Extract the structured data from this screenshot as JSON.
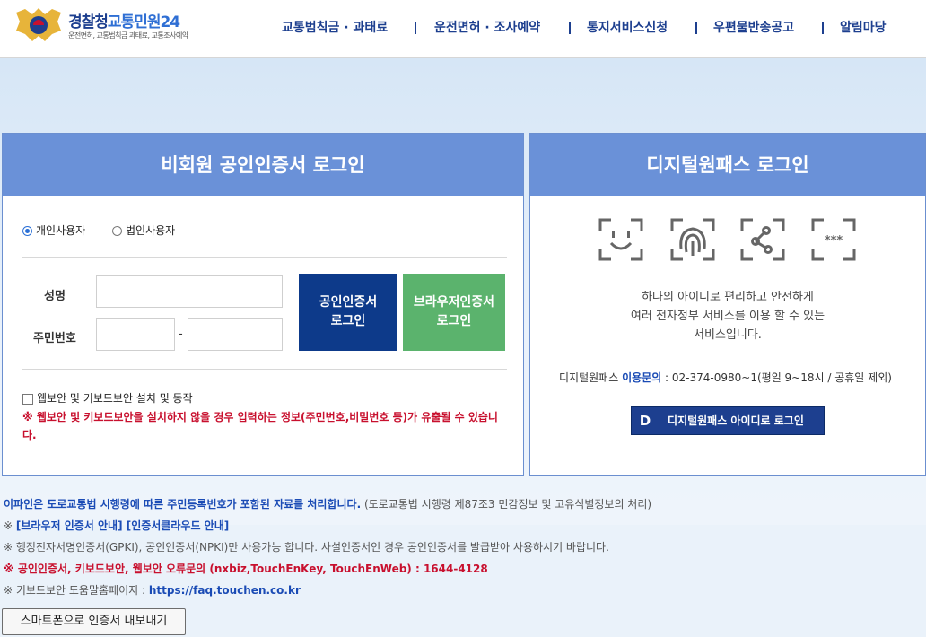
{
  "header": {
    "logo_title": "경찰청",
    "logo_title_sub": "교통민원24",
    "logo_tagline": "운전면허, 교통범칙금 과태료, 교통조사예약",
    "nav": [
      "교통범칙금 · 과태료",
      "운전면허 · 조사예약",
      "통지서비스신청",
      "우편물반송공고",
      "알림마당"
    ]
  },
  "left_panel": {
    "title": "비회원 공인인증서 로그인",
    "radio_personal": "개인사용자",
    "radio_corporate": "법인사용자",
    "label_name": "성명",
    "label_rrn": "주민번호",
    "rrn_dash": "-",
    "btn_cert": "공인인증서\n로그인",
    "btn_browser": "브라우저인증서\n로그인",
    "checkbox_label": "웹보안 및 키보드보안 설치 및 동작",
    "warning": "※ 웹보안 및 키보드보안을 설치하지 않을 경우 입력하는 정보(주민번호,비밀번호 등)가 유출될 수 있습니다."
  },
  "right_panel": {
    "title": "디지털원패스 로그인",
    "icons": [
      "face-recognition-icon",
      "fingerprint-icon",
      "pattern-icon",
      "password-icon"
    ],
    "desc_line1": "하나의 아이디로 편리하고 안전하게",
    "desc_line2": "여러 전자정부 서비스를 이용 할 수 있는",
    "desc_line3": "서비스입니다.",
    "contact_prefix": "디지털원패스 ",
    "contact_label": "이용문의",
    "contact_value": " : 02-374-0980~1(평일 9~18시 / 공휴일 제외)",
    "btn_letter": "D",
    "btn_label": "디지털원패스 아이디로 로그인"
  },
  "notes": {
    "line1_bold": "이파인은 도로교통법 시행령에 따른 주민등록번호가 포함된 자료를 처리합니다.",
    "line1_rest": " (도로교통법 시행령 제87조3 민감정보 및 고유식별정보의 처리)",
    "line2_prefix": "※ ",
    "line2_link1": "[브라우저 인증서 안내]",
    "line2_link2": " [인증서클라우드 안내]",
    "line3": "※ 행정전자서명인증서(GPKI), 공인인증서(NPKI)만 사용가능 합니다. 사설인증서인 경우 공인인증서를 발급받아 사용하시기 바랍니다.",
    "line4": "※ 공인인증서, 키보드보안, 웹보안 오류문의 (nxbiz,TouchEnKey, TouchEnWeb) : 1644-4128",
    "line5_prefix": "※ 키보드보안 도움말홈페이지 : ",
    "line5_link": "https://faq.touchen.co.kr"
  },
  "export_button": "스마트폰으로 인증서 내보내기",
  "colors": {
    "accent": "#6a91d8",
    "brand": "#1d3f8f",
    "green": "#5bb36d",
    "warning": "#c8102e"
  }
}
